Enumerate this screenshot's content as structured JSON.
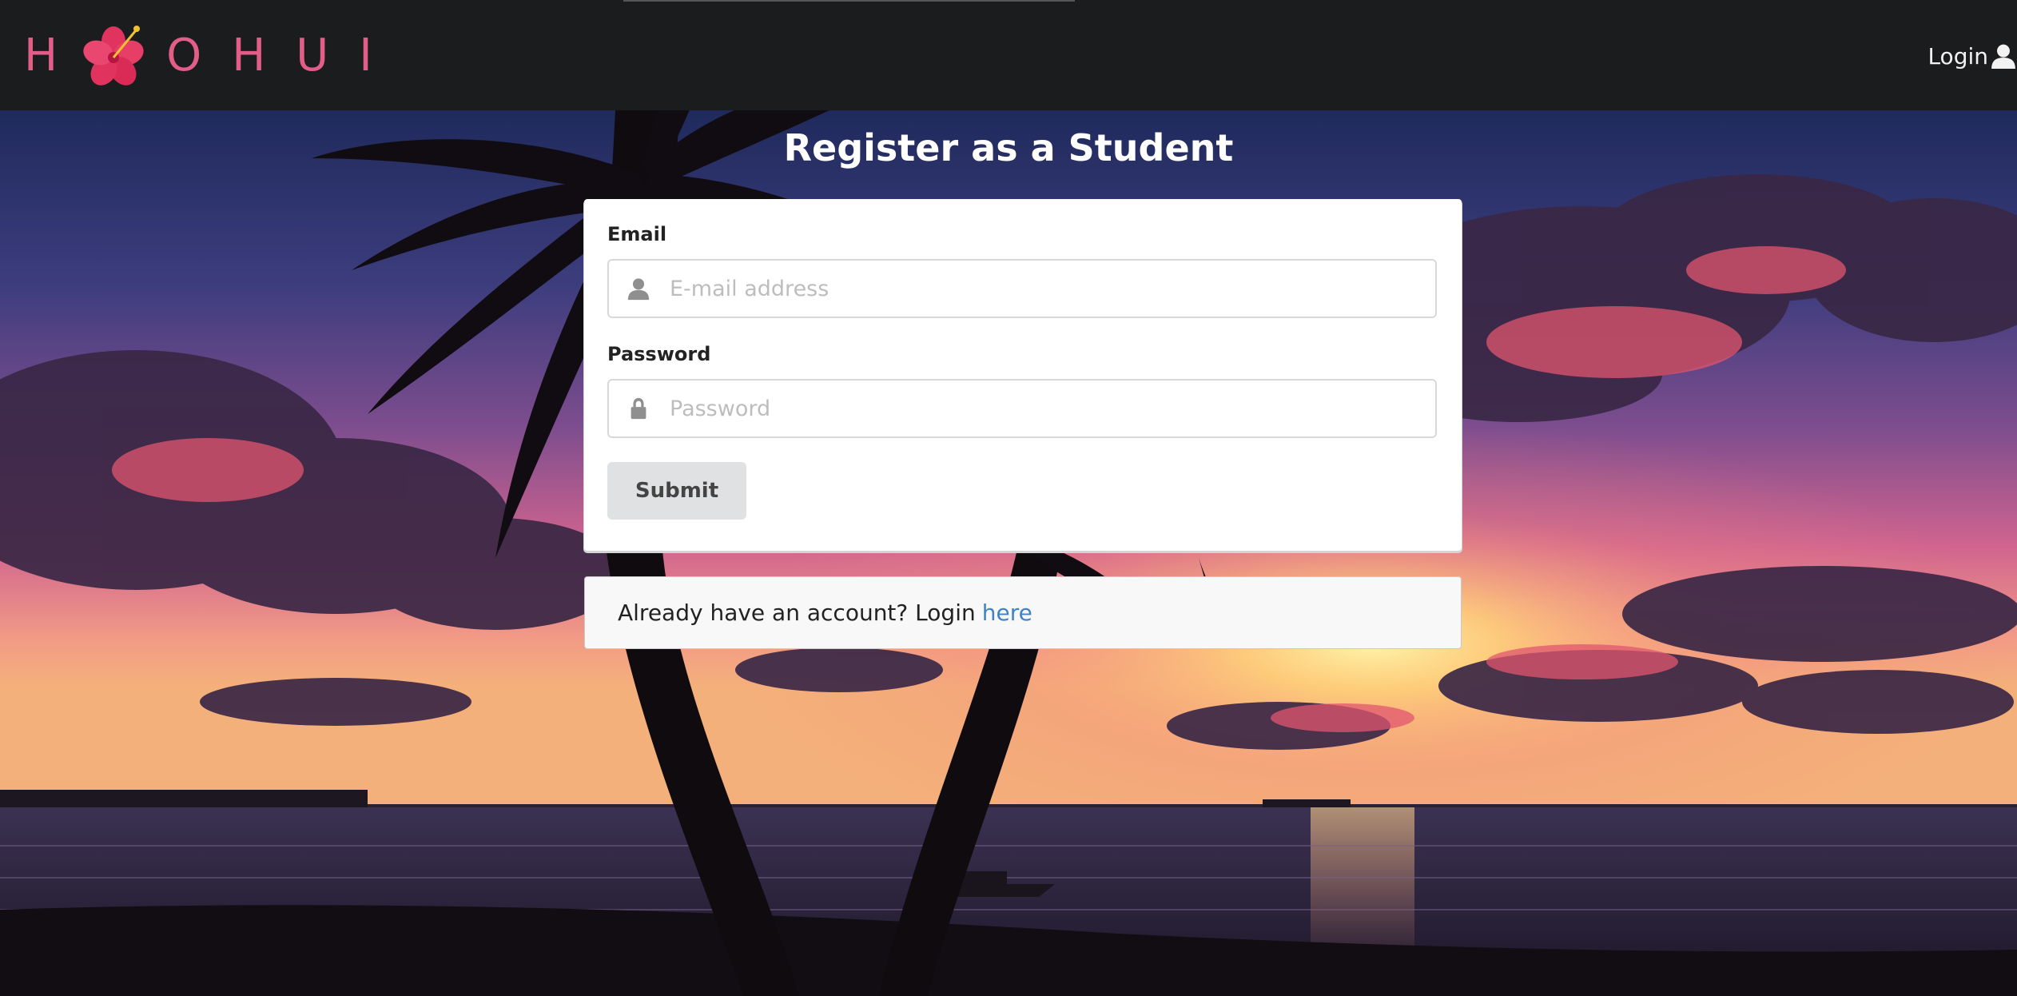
{
  "brand": {
    "logo_letter_1": "H",
    "logo_letters_2": [
      "O",
      "H",
      "U",
      "I"
    ],
    "logo_color": "#e35d89"
  },
  "nav": {
    "login_label": "Login",
    "login_icon": "user-icon"
  },
  "page": {
    "heading": "Register as a Student"
  },
  "form": {
    "email_label": "Email",
    "email_placeholder": "E-mail address",
    "email_icon": "user-icon",
    "password_label": "Password",
    "password_placeholder": "Password",
    "password_icon": "lock-icon",
    "submit_label": "Submit"
  },
  "footer_message": {
    "text": "Already have an account? Login",
    "link_text": "here",
    "link_color": "#4183c4"
  },
  "colors": {
    "topbar": "#1b1c1d",
    "button_bg": "#e0e1e2"
  }
}
